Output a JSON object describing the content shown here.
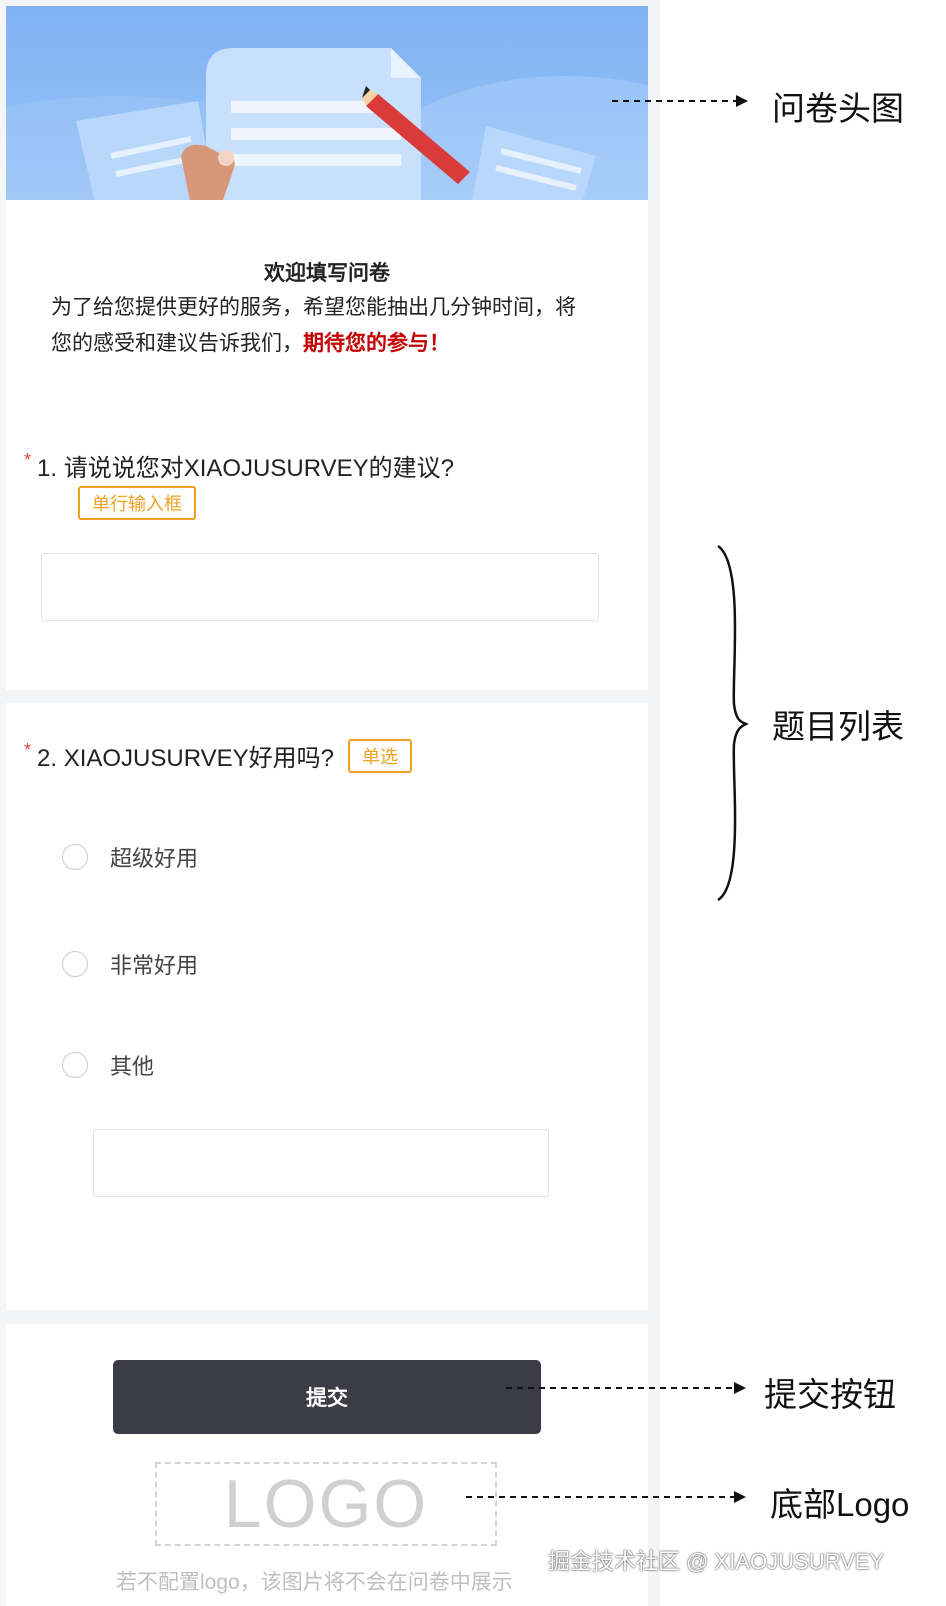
{
  "survey": {
    "intro": {
      "title": "欢迎填写问卷",
      "body": "为了给您提供更好的服务，希望您能抽出几分钟时间，将您的感受和建议告诉我们，",
      "highlight": "期待您的参与！"
    },
    "questions": [
      {
        "required_mark": "*",
        "title": "1. 请说说您对XIAOJUSURVEY的建议?",
        "type_tag": "单行输入框",
        "input_value": ""
      },
      {
        "required_mark": "*",
        "title": "2. XIAOJUSURVEY好用吗?",
        "type_tag": "单选",
        "options": [
          {
            "label": "超级好用"
          },
          {
            "label": "非常好用"
          },
          {
            "label": "其他"
          }
        ],
        "other_input_value": ""
      }
    ],
    "submit_label": "提交",
    "logo_text": "LOGO",
    "logo_note": "若不配置logo，该图片将不会在问卷中展示"
  },
  "annotations": {
    "header": "问卷头图",
    "question_list": "题目列表",
    "submit_button": "提交按钮",
    "bottom_logo": "底部Logo"
  },
  "watermark": "掘金技术社区 @ XIAOJUSURVEY",
  "colors": {
    "accent_orange": "#f0a020",
    "required_red": "#e0463a",
    "highlight_red": "#c40000",
    "button_dark": "#3b3c46",
    "banner_blue": "#8ebcf6"
  },
  "icons": [
    "survey-illustration",
    "pencil-icon",
    "radio-icon",
    "brace-icon",
    "arrow-icon"
  ]
}
